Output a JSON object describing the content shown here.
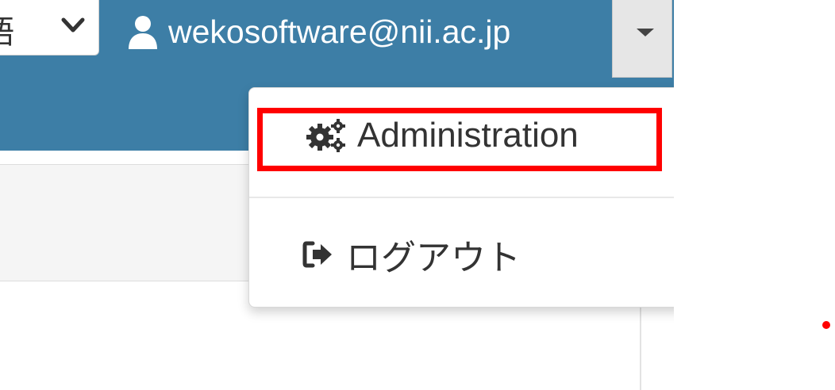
{
  "colors": {
    "brand": "#3d7ea6",
    "highlight": "#ff0000"
  },
  "header": {
    "language_select": {
      "value_fragment": "語",
      "icon": "chevron-down-icon"
    },
    "user": {
      "icon": "user-icon",
      "email": "wekosoftware@nii.ac.jp"
    },
    "menu_toggle_icon": "caret-down-icon"
  },
  "dropdown_menu": {
    "items": [
      {
        "icon": "cogs-icon",
        "label": "Administration",
        "highlighted": true
      },
      {
        "icon": "sign-out-icon",
        "label": "ログアウト",
        "highlighted": false
      }
    ]
  }
}
